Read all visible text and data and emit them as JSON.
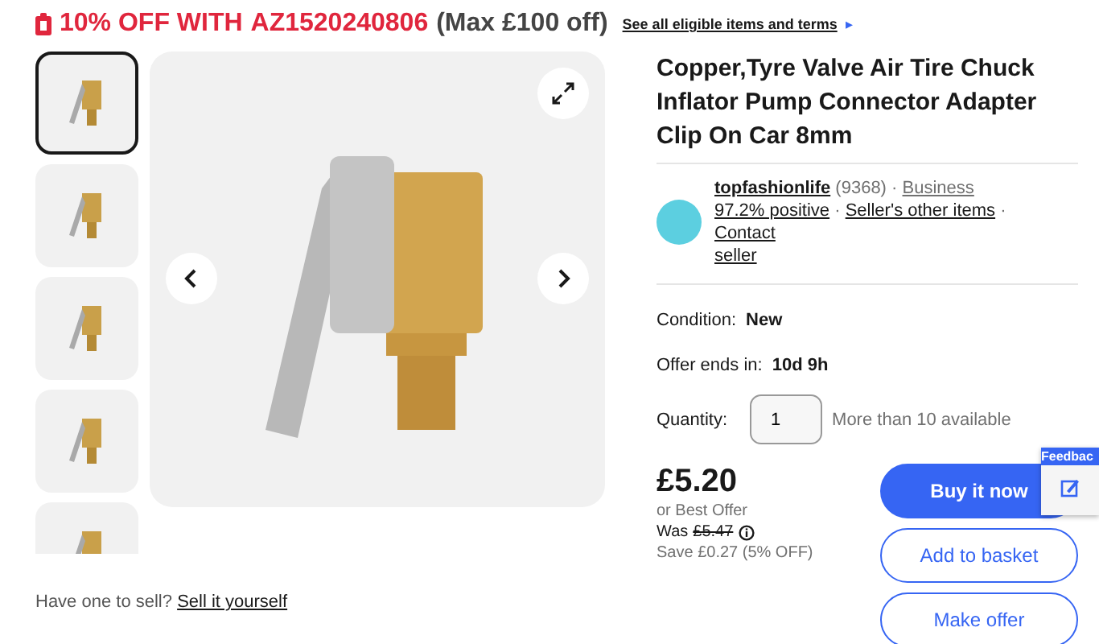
{
  "banner": {
    "percent": "10% OFF WITH",
    "code": "AZ1520240806",
    "max": "(Max £100 off)",
    "link": "See all eligible items and terms",
    "link_arrow": "▸"
  },
  "gallery": {
    "thumbnails": [
      {
        "selected": true
      },
      {
        "selected": false
      },
      {
        "selected": false
      },
      {
        "selected": false
      },
      {
        "selected": false
      }
    ],
    "sell_prompt": "Have one to sell?",
    "sell_link": "Sell it yourself"
  },
  "title": "Copper,Tyre Valve Air Tire Chuck Inflator Pump Connector Adapter Clip On Car 8mm",
  "seller": {
    "name": "topfashionlife",
    "count": "(9368)",
    "separators": [
      "·",
      "·",
      "·"
    ],
    "type": "Business",
    "positive": "97.2% positive",
    "other_items": "Seller's other items",
    "contact": "Contact seller"
  },
  "condition": {
    "label": "Condition:",
    "value": "New"
  },
  "offer": {
    "label": "Offer ends in:",
    "value": "10d 9h"
  },
  "quantity": {
    "label": "Quantity:",
    "value": "1",
    "available": "More than 10 available"
  },
  "price": {
    "amount": "£5.20",
    "best_offer": "or Best Offer",
    "was_label": "Was",
    "was_price": "£5.47",
    "save": "Save £0.27 (5% OFF)"
  },
  "buttons": [
    {
      "label": "Buy it now",
      "kind": "primary"
    },
    {
      "label": "Add to basket",
      "kind": "secondary"
    },
    {
      "label": "Make offer",
      "kind": "secondary"
    }
  ],
  "feedback": {
    "label": "Feedbac"
  }
}
